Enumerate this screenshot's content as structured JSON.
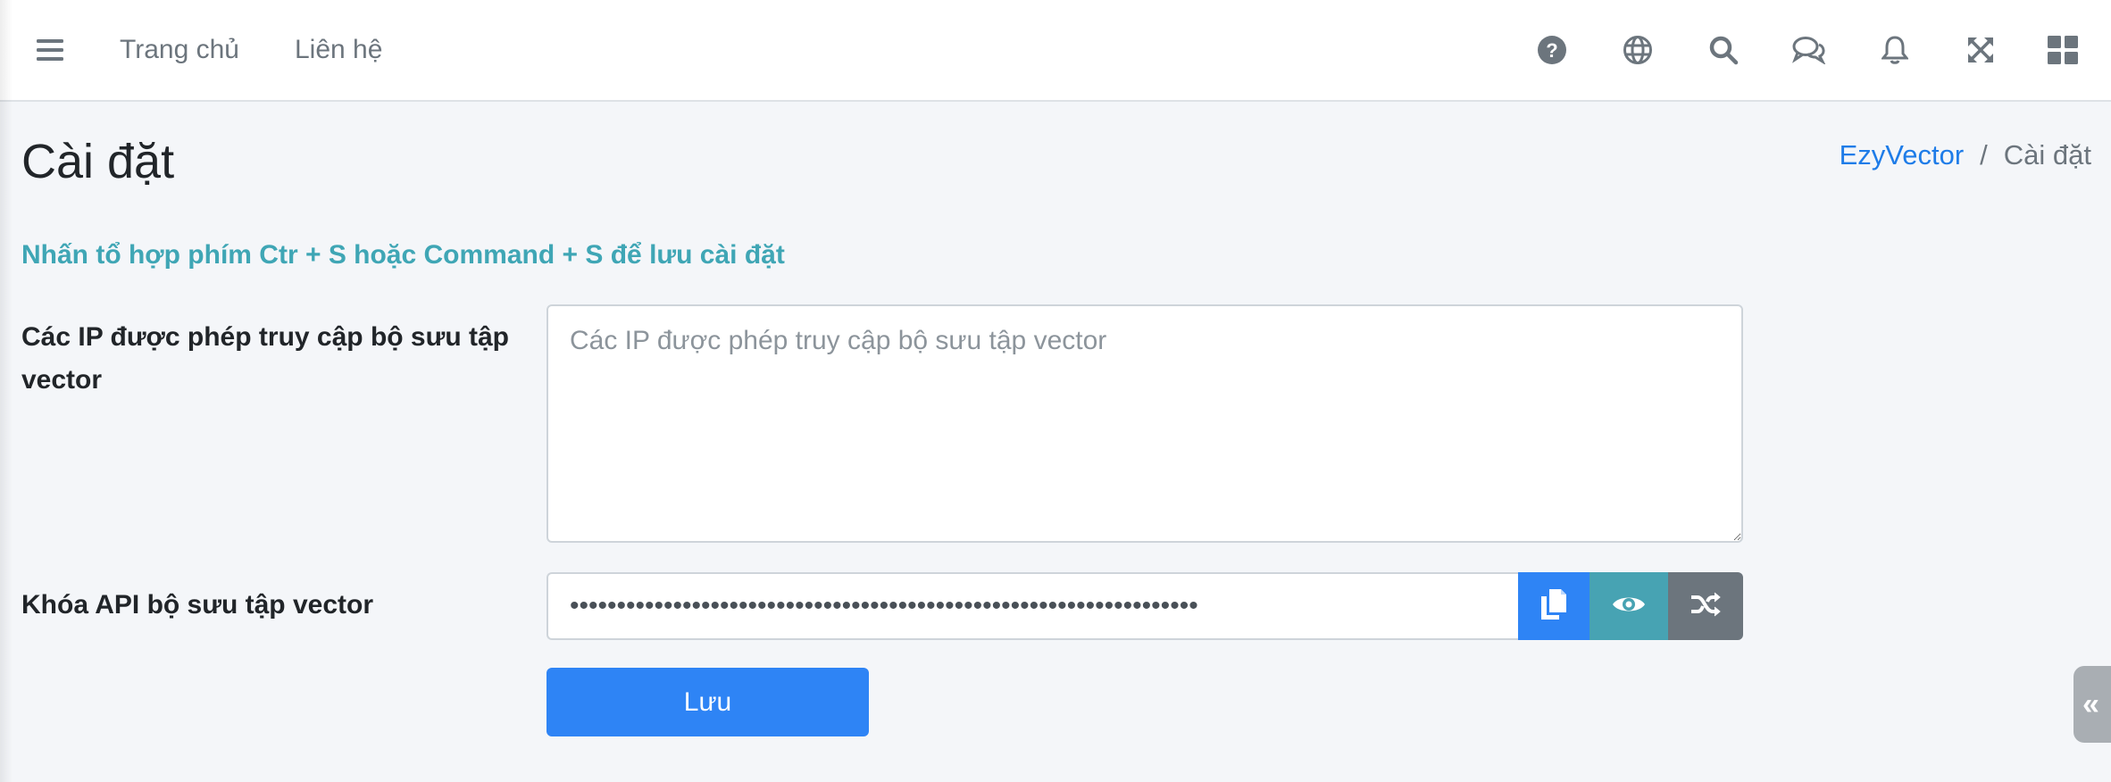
{
  "nav": {
    "links": [
      "Trang chủ",
      "Liên hệ"
    ],
    "left_icon": "menu-icon",
    "right_icons": [
      "question-icon",
      "globe-icon",
      "search-icon",
      "chat-icon",
      "bell-icon",
      "fullscreen-icon",
      "apps-grid-icon"
    ]
  },
  "page": {
    "title": "Cài đặt",
    "breadcrumb": {
      "root": "EzyVector",
      "separator": "/",
      "current": "Cài đặt"
    },
    "hint": "Nhấn tổ hợp phím Ctr + S hoặc Command + S để lưu cài đặt"
  },
  "form": {
    "ips_label": "Các IP được phép truy cập bộ sưu tập vector",
    "ips_placeholder": "Các IP được phép truy cập bộ sưu tập vector",
    "ips_value": "",
    "api_label": "Khóa API bộ sưu tập vector",
    "api_value_masked": "•••••••••••••••••••••••••••••••••••••••••••••••••••••••••••••••••••",
    "save_label": "Lưu"
  },
  "side_toggle": "«",
  "colors": {
    "primary": "#2e84f5",
    "info": "#47a3b3",
    "secondary": "#6c757d",
    "hint": "#3fa6b5",
    "link": "#1e7ce8"
  }
}
